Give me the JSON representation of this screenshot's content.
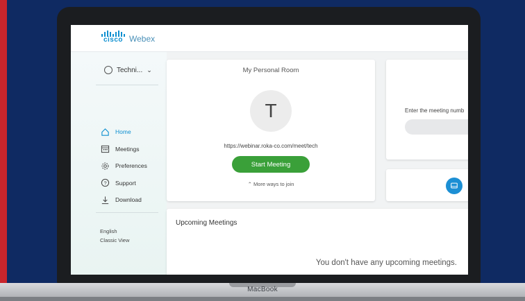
{
  "device": {
    "brand": "MacBook"
  },
  "app": {
    "logo_cisco": "cisco",
    "logo_webex": "Webex"
  },
  "sidebar": {
    "user": "Techni...",
    "items": [
      {
        "label": "Home",
        "icon": "home-icon",
        "active": true
      },
      {
        "label": "Meetings",
        "icon": "calendar-icon",
        "active": false
      },
      {
        "label": "Preferences",
        "icon": "gear-icon",
        "active": false
      },
      {
        "label": "Support",
        "icon": "help-icon",
        "active": false
      },
      {
        "label": "Download",
        "icon": "download-icon",
        "active": false
      }
    ],
    "footer": {
      "language": "English",
      "classic_view": "Classic View"
    }
  },
  "personal_room": {
    "title": "My Personal Room",
    "avatar_letter": "T",
    "url": "https://webinar.roka-co.com/meet/tech",
    "start_button": "Start Meeting",
    "more_ways": "More ways to join"
  },
  "join": {
    "label": "Enter the meeting numb"
  },
  "upcoming": {
    "title": "Upcoming Meetings",
    "empty_message": "You don't have any upcoming meetings."
  },
  "colors": {
    "accent": "#0d8fd0",
    "start_green": "#3aa039",
    "background": "#0f2a62",
    "stripe": "#c8252c"
  }
}
